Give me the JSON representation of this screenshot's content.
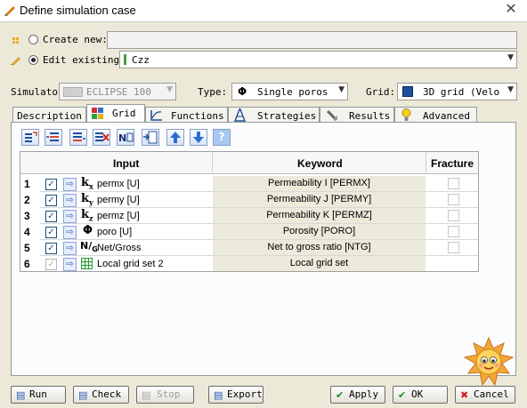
{
  "window": {
    "title": "Define simulation case",
    "close": "✕"
  },
  "create": {
    "label": "Create new:",
    "value": ""
  },
  "edit": {
    "label": "Edit existing:",
    "value": "Czz"
  },
  "simulator": {
    "label": "Simulator:",
    "value": "ECLIPSE 100"
  },
  "type": {
    "label": "Type:",
    "value": "Single poros"
  },
  "grid_sel": {
    "label": "Grid:",
    "value": "3D grid (Velo"
  },
  "tabs": [
    "Description",
    "Grid",
    "Functions",
    "Strategies",
    "Results",
    "Advanced"
  ],
  "table": {
    "headers": {
      "input": "Input",
      "keyword": "Keyword",
      "fracture": "Fracture"
    },
    "rows": [
      {
        "num": "1",
        "input": "permx [U]",
        "keyword": "Permeability I [PERMX]"
      },
      {
        "num": "2",
        "input": "permy [U]",
        "keyword": "Permeability J [PERMY]"
      },
      {
        "num": "3",
        "input": "permz [U]",
        "keyword": "Permeability K [PERMZ]"
      },
      {
        "num": "4",
        "input": "poro [U]",
        "keyword": "Porosity [PORO]"
      },
      {
        "num": "5",
        "input": "Net/Gross",
        "keyword": "Net to gross ratio [NTG]"
      },
      {
        "num": "6",
        "input": "Local grid set 2",
        "keyword": "Local grid set"
      }
    ]
  },
  "buttons": {
    "run": "Run",
    "check": "Check",
    "stop": "Stop",
    "export": "Export",
    "apply": "Apply",
    "ok": "OK",
    "cancel": "Cancel"
  }
}
